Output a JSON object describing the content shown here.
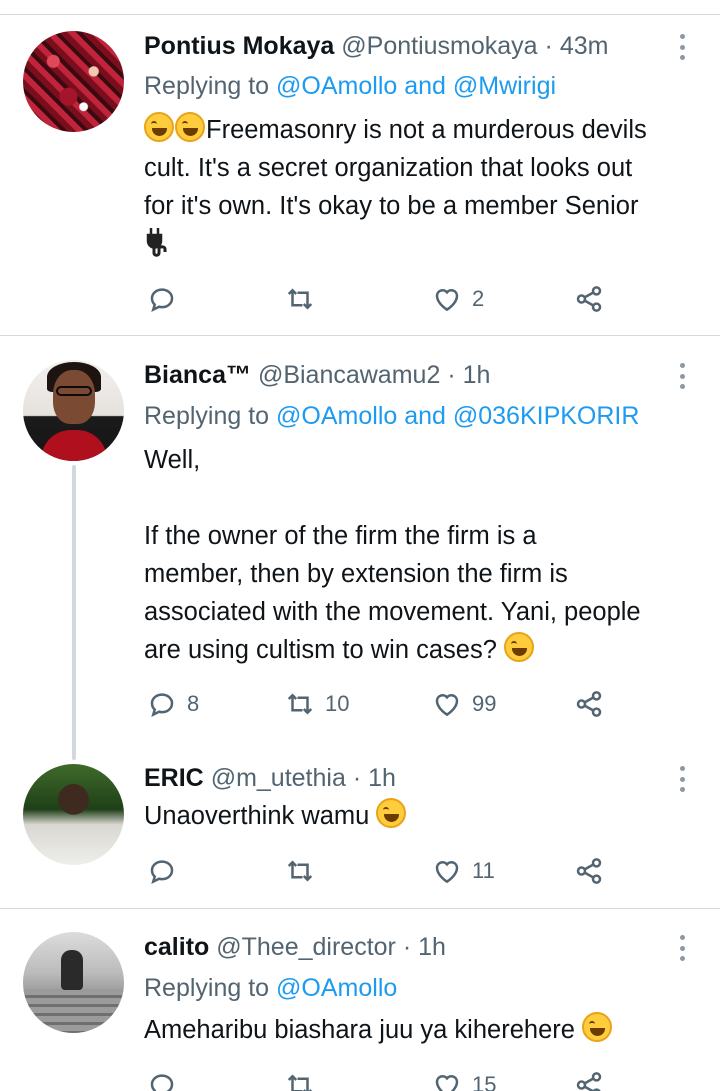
{
  "tweets": [
    {
      "name": "Pontius Mokaya",
      "handle": "@Pontiusmokaya",
      "dot": "·",
      "time": "43m",
      "replying_prefix": "Replying to",
      "replying_mentions": "@OAmollo and @Mwirigi",
      "text_lines": [
        "Freemasonry is not a murderous devils",
        "cult. It's a secret organization that looks out",
        "for it's own. It's okay to be a member Senior"
      ],
      "replies": "",
      "retweets": "",
      "likes": "2"
    },
    {
      "name": "Bianca™",
      "handle": "@Biancawamu2",
      "dot": "·",
      "time": "1h",
      "replying_prefix": "Replying to",
      "replying_mentions": "@OAmollo and @036KIPKORIR",
      "text_lines": [
        "Well,",
        "If the owner of the firm the firm is a",
        "member, then by extension the firm is",
        "associated with the movement. Yani, people",
        "are using cultism to win cases?"
      ],
      "replies": "8",
      "retweets": "10",
      "likes": "99"
    },
    {
      "name": "ERIC",
      "handle": "@m_utethia",
      "dot": "·",
      "time": "1h",
      "text_lines": [
        "Unaoverthink wamu"
      ],
      "replies": "",
      "retweets": "",
      "likes": "11"
    },
    {
      "name": "calito",
      "handle": "@Thee_director",
      "dot": "·",
      "time": "1h",
      "replying_prefix": "Replying to",
      "replying_mentions": "@OAmollo",
      "text_lines": [
        "Ameharibu biashara juu ya kiherehere"
      ],
      "replies": "",
      "retweets": "",
      "likes": "15"
    }
  ],
  "icons": {
    "reply": "reply-icon",
    "retweet": "retweet-icon",
    "like": "heart-icon",
    "share": "share-icon",
    "more": "more-options-icon",
    "emoji": "face-with-tears-of-joy-emoji",
    "plug": "electric-plug-emoji"
  },
  "colors": {
    "link": "#1d9bf0",
    "secondary_text": "#536471",
    "divider": "#cfd9de"
  }
}
